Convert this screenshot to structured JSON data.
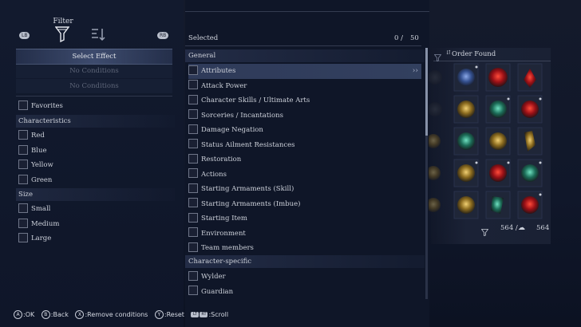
{
  "filter": {
    "title": "Filter",
    "lb": "LB",
    "rb": "RB",
    "select_effect": "Select Effect",
    "no_conditions_1": "No Conditions",
    "no_conditions_2": "No Conditions",
    "favorites": "Favorites",
    "characteristics_label": "Characteristics",
    "colors": [
      "Red",
      "Blue",
      "Yellow",
      "Green"
    ],
    "size_label": "Size",
    "sizes": [
      "Small",
      "Medium",
      "Large"
    ]
  },
  "selected": {
    "label": "Selected",
    "count": "0 /",
    "max": "50"
  },
  "general": {
    "label": "General",
    "items": [
      "Attributes",
      "Attack Power",
      "Character Skills / Ultimate Arts",
      "Sorceries / Incantations",
      "Damage Negation",
      "Status Ailment Resistances",
      "Restoration",
      "Actions",
      "Starting Armaments (Skill)",
      "Starting Armaments (Imbue)",
      "Starting Item",
      "Environment",
      "Team members"
    ]
  },
  "character_specific": {
    "label": "Character-specific",
    "items": [
      "Wylder",
      "Guardian"
    ]
  },
  "inventory": {
    "sort_label": "Order Found",
    "filtered_count": "564 /",
    "total_count": "564"
  },
  "hints": {
    "ok": ":OK",
    "back": ":Back",
    "remove": ":Remove conditions",
    "reset": ":Reset",
    "scroll": ":Scroll"
  },
  "colors": {
    "accent": "#4e5f8c",
    "red_relic": "#c8232a",
    "blue_relic": "#3d5fa8",
    "yellow_relic": "#c8a23a",
    "green_relic": "#2d9c7a"
  }
}
